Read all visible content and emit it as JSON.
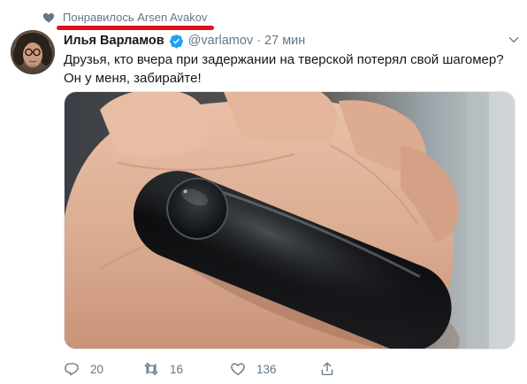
{
  "context": {
    "liked_by_text": "Понравилось Arsen Avakov",
    "icon": "heart-icon"
  },
  "author": {
    "name": "Илья Варламов",
    "handle": "@varlamov",
    "separator": "·",
    "time": "27 мин",
    "verified_icon": "verified-badge-icon"
  },
  "tweet": {
    "line1": "Друзья, кто вчера при задержании на тверской потерял свой шагомер?",
    "line2": "Он у меня, забирайте!"
  },
  "actions": {
    "reply_count": "20",
    "retweet_count": "16",
    "like_count": "136"
  },
  "colors": {
    "accent": "#1da1f2",
    "muted": "#657786",
    "underline": "#e0101e"
  }
}
